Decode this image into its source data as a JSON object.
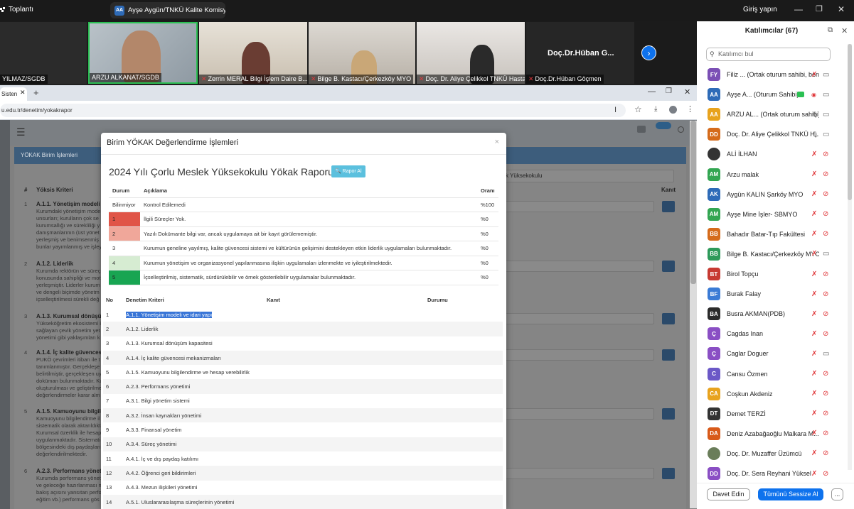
{
  "zoom": {
    "meeting_label": "Toplantı",
    "share_initials": "AA",
    "share_label": "Ayşe Aygün/TNKÜ Kalite Komisy",
    "login": "Giriş yapın"
  },
  "videos": [
    {
      "name": "YILMAZ/SGDB",
      "muted": false
    },
    {
      "name": "ARZU ALKANAT/SGDB",
      "muted": false
    },
    {
      "name": "Zerrin MERAL Bilgi İşlem Daire B...",
      "muted": true
    },
    {
      "name": "Bilge B. Kastacı/Çerkezköy MYO",
      "muted": true
    },
    {
      "name": "Doç. Dr. Aliye Çelikkol TNKÜ Hastan...",
      "muted": true
    },
    {
      "name": "Doç.Dr.Hüban Göçmen",
      "muted": true
    }
  ],
  "video_center_name": "Doç.Dr.Hüban  G...",
  "browser": {
    "tab_label": "Sisten",
    "url": "u.edu.tr/denetim/yokakrapor"
  },
  "bgpage": {
    "panel_title": "YÖKAK Birim İşlemleri",
    "col_no": "#",
    "col_kriter": "Yöksis Kriteri",
    "col_kanit": "Kanıt",
    "dropdown_text": "k Yüksekokulu",
    "rows": [
      {
        "no": "1",
        "title": "A.1.1. Yönetişim modeli v",
        "lines": [
          "Kurumdaki yönetişim mode",
          "unsurları; kurulların çok se",
          "kurumsallığı ve sürekliliği y",
          "danışmanlarının (üst yönet",
          "yerleşmiş ve benimsenmiş",
          "bunlar yayımlanmış ve işley"
        ]
      },
      {
        "no": "2",
        "title": "A.1.2. Liderlik",
        "lines": [
          "Kurumda rektörün ve süreç",
          "konusunda sahipliği ve mot",
          "yerleşmiştir. Liderler kurum",
          "ve dengeli biçimde yönetm",
          "içselleştirilmesi sürekli değ"
        ]
      },
      {
        "no": "3",
        "title": "A.1.3. Kurumsal dönüşüm",
        "lines": [
          "Yükseköğretim ekosistemi i",
          "sağlayan çevik yönetim yet",
          "yönetimi gibi yaklaşımları k"
        ]
      },
      {
        "no": "4",
        "title": "A.1.4. İç kalite güvencesi",
        "lines": [
          "PUKÖ çevrimleri itibarı ile t",
          "tanımlanmıştır. Gerçekleşe",
          "belirtilmiştir, gerçekleşen uy",
          "doküman bulunmaktadır. Ku",
          "oluşturulması ve geliştirilme",
          "değerlendirmeler karar alm"
        ]
      },
      {
        "no": "5",
        "title": "A.1.5. Kamuoyunu bilgile",
        "lines": [
          "Kamuoyunu bilgilendirme il",
          "sistematik olarak aktarıldıktan",
          "Kurumsal özerklik ile hesap",
          "uygulanmaktadır. Sistemati",
          "bölgesindeki dış paydaşları",
          "değerlendirilmektedir."
        ]
      },
      {
        "no": "6",
        "title": "A.2.3. Performans yöneti",
        "lines": [
          "Kurumda performans yönet",
          "ve geleceğe hazırlanması n",
          "bakış açısını yansıtan perfo",
          "eğitim vb.) performans gös"
        ]
      }
    ]
  },
  "modal": {
    "title": "Birim YÖKAK Değerlendirme İşlemleri",
    "close": "×",
    "report_title": "2024 Yılı Çorlu Meslek Yüksekokulu Yökak Raporu",
    "report_button": "Rapor Al",
    "legend_headers": [
      "Durum",
      "Açıklama",
      "Oranı"
    ],
    "legend": [
      {
        "durum": "Bilinmiyor",
        "aciklama": "Kontrol Edilemedi",
        "orani": "%100",
        "color": "#ffffff"
      },
      {
        "durum": "1",
        "aciklama": "İlgili Süreçler Yok.",
        "orani": "%0",
        "color": "#e05548"
      },
      {
        "durum": "2",
        "aciklama": "Yazılı Dokümante bilgi var, ancak uygulamaya ait bir kayıt görülememiştir.",
        "orani": "%0",
        "color": "#f0a79a"
      },
      {
        "durum": "3",
        "aciklama": "Kurumun geneline yayılmış, kalite güvencesi sistemi ve kültürünün gelişimini destekleyen etkin liderlik uygulamaları bulunmaktadır.",
        "orani": "%0",
        "color": "#ffffff"
      },
      {
        "durum": "4",
        "aciklama": "Kurumun yönetişim ve organizasyonel yapılanmasına ilişkin uygulamaları izlenmekte ve iyileştirilmektedir.",
        "orani": "%0",
        "color": "#d6ecd2"
      },
      {
        "durum": "5",
        "aciklama": "İçselleştirilmiş, sistematik, sürdürülebilir ve örnek gösterilebilir uygulamalar bulunmaktadır.",
        "orani": "%0",
        "color": "#18a552"
      }
    ],
    "crit_headers": [
      "No",
      "Denetim Kriteri",
      "Kanıt",
      "Durumu"
    ],
    "criteria": [
      {
        "no": "1",
        "name": "A.1.1. Yönetişim modeli ve idari yapı"
      },
      {
        "no": "2",
        "name": "A.1.2. Liderlik"
      },
      {
        "no": "3",
        "name": "A.1.3. Kurumsal dönüşüm kapasitesi"
      },
      {
        "no": "4",
        "name": "A.1.4. İç kalite güvencesi mekanizmaları"
      },
      {
        "no": "5",
        "name": "A.1.5. Kamuoyunu bilgilendirme ve hesap verebilirlik"
      },
      {
        "no": "6",
        "name": "A.2.3. Performans yönetimi"
      },
      {
        "no": "7",
        "name": "A.3.1. Bilgi yönetim sistemi"
      },
      {
        "no": "8",
        "name": "A.3.2. İnsan kaynakları yönetimi"
      },
      {
        "no": "9",
        "name": "A.3.3. Finansal yönetim"
      },
      {
        "no": "10",
        "name": "A.3.4. Süreç yönetimi"
      },
      {
        "no": "11",
        "name": "A.4.1. İç ve dış paydaş katılımı"
      },
      {
        "no": "12",
        "name": "A.4.2. Öğrenci geri bildirimleri"
      },
      {
        "no": "13",
        "name": "A.4.3. Mezun ilişkileri yönetimi"
      },
      {
        "no": "14",
        "name": "A.5.1. Uluslararasılaşma süreçlerinin yönetimi"
      }
    ]
  },
  "participants": {
    "header": "Katılımcılar (67)",
    "search_placeholder": "Katılımcı bul",
    "list": [
      {
        "initials": "FY",
        "name": "Filiz ... (Ortak oturum sahibi, ben)",
        "color": "#7b4fb5"
      },
      {
        "initials": "AA",
        "name": "Ayşe A... (Oturum Sahibi)",
        "color": "#2e6bb8"
      },
      {
        "initials": "AA",
        "name": "ARZU AL...  (Ortak oturum sahibi)",
        "color": "#e8a31e"
      },
      {
        "initials": "DD",
        "name": "Doç. Dr. Aliye Çelikkol TNKÜ H...",
        "color": "#d56b1b"
      },
      {
        "initials": "",
        "name": "ALİ İLHAN",
        "color": "#333333"
      },
      {
        "initials": "AM",
        "name": "Arzu malak",
        "color": "#33a652"
      },
      {
        "initials": "AK",
        "name": "Aygün KALIN Şarköy MYO",
        "color": "#2e6bb8"
      },
      {
        "initials": "AM",
        "name": "Ayşe Mine İşler- SBMYO",
        "color": "#33a652"
      },
      {
        "initials": "BB",
        "name": "Bahadır Batar-Tıp Fakültesi",
        "color": "#d56b1b"
      },
      {
        "initials": "BB",
        "name": "Bilge B. Kastacı/Çerkezköy MYO",
        "color": "#2e9a5a"
      },
      {
        "initials": "BT",
        "name": "Birol Topçu",
        "color": "#c73a32"
      },
      {
        "initials": "BF",
        "name": "Burak Falay",
        "color": "#3a7bd5"
      },
      {
        "initials": "BA",
        "name": "Busra AKMAN(PDB)",
        "color": "#2b2b2b"
      },
      {
        "initials": "Ç",
        "name": "Cagdas Inan",
        "color": "#8a4fc4"
      },
      {
        "initials": "Ç",
        "name": "Caglar Doguer",
        "color": "#8a4fc4"
      },
      {
        "initials": "C",
        "name": "Cansu Özmen",
        "color": "#6b58c7"
      },
      {
        "initials": "CA",
        "name": "Coşkun Akdeniz",
        "color": "#e8a31e"
      },
      {
        "initials": "DT",
        "name": "Demet TERZİ",
        "color": "#333333"
      },
      {
        "initials": "DA",
        "name": "Deniz Azabağaoğlu Malkara M...",
        "color": "#d85a1a"
      },
      {
        "initials": "",
        "name": "Doç. Dr. Muzaffer Üzümcü",
        "color": "#6a7d5a"
      },
      {
        "initials": "DD",
        "name": "Doç. Dr. Sera Reyhani Yüksel",
        "color": "#8a4fc4"
      }
    ],
    "invite": "Davet Edin",
    "mute_all": "Tümünü Sessize Al",
    "more": "..."
  },
  "colors": {
    "accent": "#0e72ed",
    "mute": "#e0373a",
    "panel_head": "#3d5d7c"
  }
}
